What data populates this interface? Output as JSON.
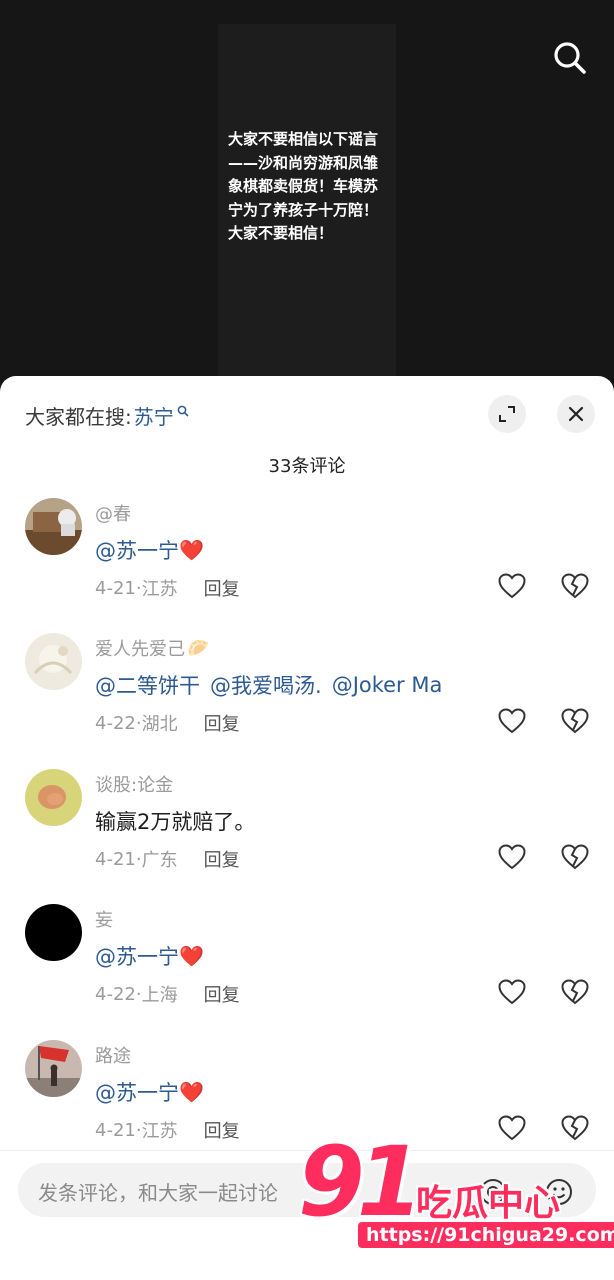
{
  "video": {
    "overlay_text": "大家不要相信以下谣言——沙和尚穷游和凤雏象棋都卖假货！车模苏宁为了养孩子十万陪！大家不要相信！",
    "search_icon": "search-icon"
  },
  "sheet": {
    "suggest_prefix": "大家都在搜:",
    "suggest_keyword": "苏宁",
    "comment_count": "33条评论",
    "expand_icon": "expand-icon",
    "close_icon": "close-icon"
  },
  "comments": [
    {
      "user": "@春",
      "segments": [
        {
          "text": "@苏一宁",
          "mention": true
        }
      ],
      "emoji": "❤️",
      "date": "4-21",
      "location": "江苏",
      "reply": "回复"
    },
    {
      "user": "爱人先爱己",
      "user_emoji": "🥟",
      "segments": [
        {
          "text": "@二等饼干",
          "mention": true
        },
        {
          "text": "@我爱喝汤.",
          "mention": true
        },
        {
          "text": "@Joker Ma",
          "mention": true
        }
      ],
      "date": "4-22",
      "location": "湖北",
      "reply": "回复"
    },
    {
      "user": "谈股:论金",
      "segments": [
        {
          "text": "输赢2万就赔了。",
          "mention": false
        }
      ],
      "date": "4-21",
      "location": "广东",
      "reply": "回复"
    },
    {
      "user": "妄",
      "segments": [
        {
          "text": "@苏一宁",
          "mention": true
        }
      ],
      "emoji": "❤️",
      "date": "4-22",
      "location": "上海",
      "reply": "回复"
    },
    {
      "user": "路途",
      "segments": [
        {
          "text": "@苏一宁",
          "mention": true
        }
      ],
      "emoji": "❤️",
      "date": "4-21",
      "location": "江苏",
      "reply": "回复"
    }
  ],
  "input": {
    "placeholder": "发条评论，和大家一起讨论",
    "at_icon": "at-icon",
    "emoji_icon": "emoji-icon"
  },
  "watermark": {
    "logo": "91",
    "name": "吃瓜中心",
    "url": "https://91chigua29.com"
  },
  "colors": {
    "mention": "#2c5a92",
    "heart": "#e8262f",
    "watermark": "#ff2d5e"
  }
}
